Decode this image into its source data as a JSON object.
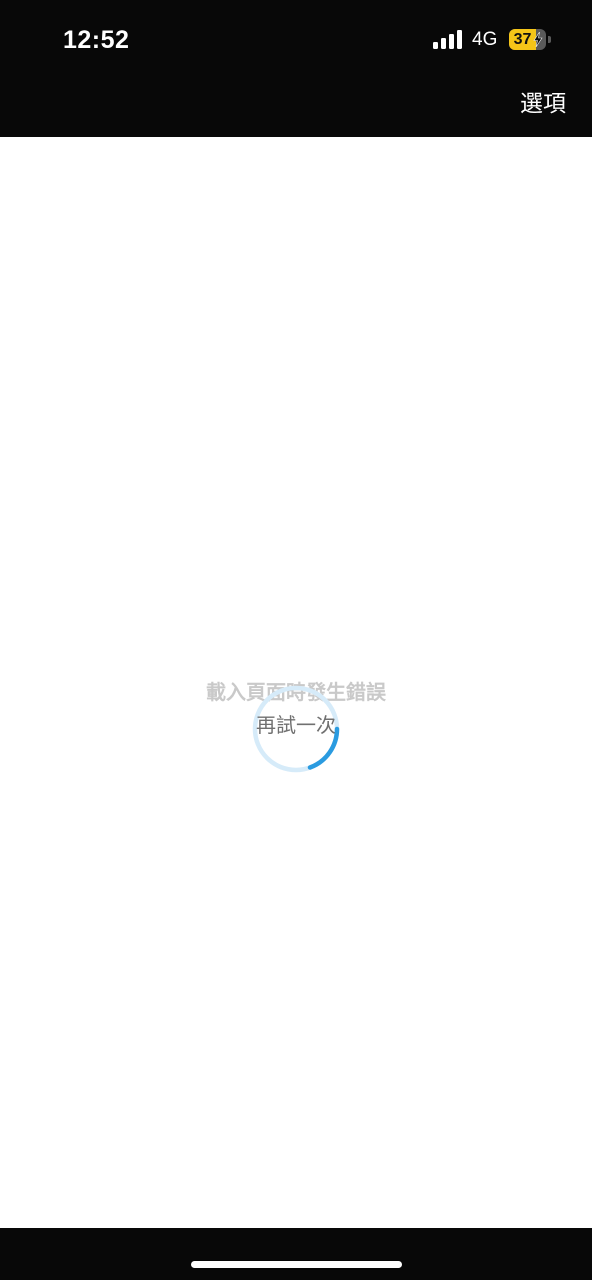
{
  "status_bar": {
    "time": "12:52",
    "network": "4G",
    "battery_level": "37",
    "battery_fraction": 0.37,
    "signal_icon": "signal-bars-icon",
    "charging_icon": "bolt-icon"
  },
  "nav_bar": {
    "options_label": "選項"
  },
  "content": {
    "error_message": "載入頁面時發生錯誤",
    "retry_label": "再試一次",
    "spinner_icon": "loading-spinner-icon"
  },
  "colors": {
    "bars_background": "#080808",
    "content_background": "#ffffff",
    "battery_accent": "#f5c518",
    "spinner_accent": "#2a9be0",
    "spinner_track": "#d6ebf9"
  }
}
